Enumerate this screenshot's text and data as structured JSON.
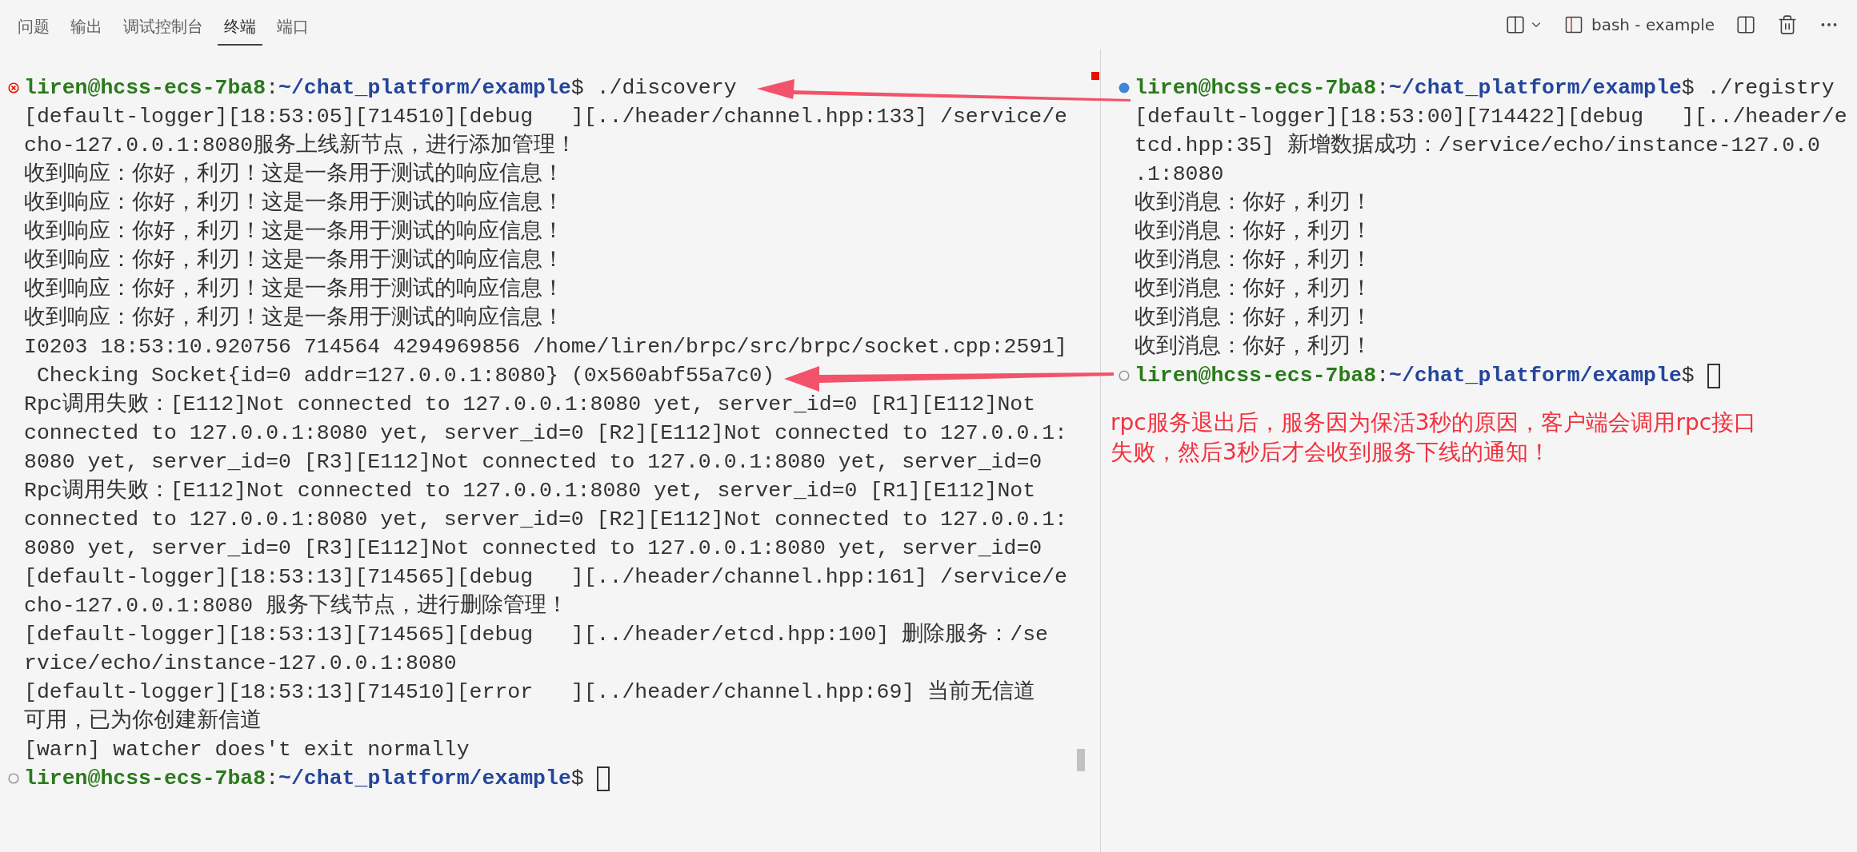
{
  "tabs": [
    {
      "label": "问题",
      "selected": false
    },
    {
      "label": "输出",
      "selected": false
    },
    {
      "label": "调试控制台",
      "selected": false
    },
    {
      "label": "终端",
      "selected": true
    },
    {
      "label": "端口",
      "selected": false
    }
  ],
  "terminal_name": "bash - example",
  "terminals": [
    {
      "lines": [
        {
          "kind": "prompt",
          "error": true,
          "color": "#e51400",
          "user": "liren@hcss-ecs-7ba8",
          "sep": ":",
          "path": "~/chat_platform/example",
          "symbol": "$",
          "command": "./discovery"
        },
        {
          "kind": "output",
          "text": "[default-logger][18:53:05][714510][debug   ][../header/channel.hpp:133] /service/e"
        },
        {
          "kind": "output",
          "text": "cho-127.0.0.1:8080服务上线新节点，进行添加管理！"
        },
        {
          "kind": "output",
          "text": "收到响应：你好，利刃！这是一条用于测试的响应信息！"
        },
        {
          "kind": "output",
          "text": "收到响应：你好，利刃！这是一条用于测试的响应信息！"
        },
        {
          "kind": "output",
          "text": "收到响应：你好，利刃！这是一条用于测试的响应信息！"
        },
        {
          "kind": "output",
          "text": "收到响应：你好，利刃！这是一条用于测试的响应信息！"
        },
        {
          "kind": "output",
          "text": "收到响应：你好，利刃！这是一条用于测试的响应信息！"
        },
        {
          "kind": "output",
          "text": "收到响应：你好，利刃！这是一条用于测试的响应信息！"
        },
        {
          "kind": "output",
          "text": "I0203 18:53:10.920756 714564 4294969856 /home/liren/brpc/src/brpc/socket.cpp:2591]"
        },
        {
          "kind": "output",
          "text": " Checking Socket{id=0 addr=127.0.0.1:8080} (0x560abf55a7c0)"
        },
        {
          "kind": "output",
          "text": "Rpc调用失败：[E112]Not connected to 127.0.0.1:8080 yet, server_id=0 [R1][E112]Not"
        },
        {
          "kind": "output",
          "text": "connected to 127.0.0.1:8080 yet, server_id=0 [R2][E112]Not connected to 127.0.0.1:"
        },
        {
          "kind": "output",
          "text": "8080 yet, server_id=0 [R3][E112]Not connected to 127.0.0.1:8080 yet, server_id=0"
        },
        {
          "kind": "output",
          "text": "Rpc调用失败：[E112]Not connected to 127.0.0.1:8080 yet, server_id=0 [R1][E112]Not"
        },
        {
          "kind": "output",
          "text": "connected to 127.0.0.1:8080 yet, server_id=0 [R2][E112]Not connected to 127.0.0.1:"
        },
        {
          "kind": "output",
          "text": "8080 yet, server_id=0 [R3][E112]Not connected to 127.0.0.1:8080 yet, server_id=0"
        },
        {
          "kind": "output",
          "text": "[default-logger][18:53:13][714565][debug   ][../header/channel.hpp:161] /service/e"
        },
        {
          "kind": "output",
          "text": "cho-127.0.0.1:8080 服务下线节点，进行删除管理！"
        },
        {
          "kind": "output",
          "text": "[default-logger][18:53:13][714565][debug   ][../header/etcd.hpp:100] 删除服务：/se"
        },
        {
          "kind": "output",
          "text": "rvice/echo/instance-127.0.0.1:8080"
        },
        {
          "kind": "output",
          "text": "[default-logger][18:53:13][714510][error   ][../header/channel.hpp:69] 当前无信道"
        },
        {
          "kind": "output",
          "text": "可用，已为你创建新信道"
        },
        {
          "kind": "output",
          "text": "[warn] watcher does't exit normally"
        },
        {
          "kind": "prompt",
          "error": false,
          "filled": false,
          "color": "#999999",
          "user": "liren@hcss-ecs-7ba8",
          "sep": ":",
          "path": "~/chat_platform/example",
          "symbol": "$",
          "cursor": true
        }
      ]
    },
    {
      "lines": [
        {
          "kind": "prompt",
          "error": false,
          "filled": true,
          "color": "#3f87d6",
          "user": "liren@hcss-ecs-7ba8",
          "sep": ":",
          "path": "~/chat_platform/example",
          "symbol": "$",
          "command": "./registry"
        },
        {
          "kind": "output",
          "text": "[default-logger][18:53:00][714422][debug   ][../header/e"
        },
        {
          "kind": "output",
          "text": "tcd.hpp:35] 新增数据成功：/service/echo/instance-127.0.0"
        },
        {
          "kind": "output",
          "text": ".1:8080"
        },
        {
          "kind": "output",
          "text": "收到消息：你好，利刃！"
        },
        {
          "kind": "output",
          "text": "收到消息：你好，利刃！"
        },
        {
          "kind": "output",
          "text": "收到消息：你好，利刃！"
        },
        {
          "kind": "output",
          "text": "收到消息：你好，利刃！"
        },
        {
          "kind": "output",
          "text": "收到消息：你好，利刃！"
        },
        {
          "kind": "output",
          "text": "收到消息：你好，利刃！"
        },
        {
          "kind": "prompt",
          "error": false,
          "filled": false,
          "color": "#999999",
          "user": "liren@hcss-ecs-7ba8",
          "sep": ":",
          "path": "~/chat_platform/example",
          "symbol": "$",
          "cursor": true
        }
      ],
      "annotation": [
        "rpc服务退出后，服务因为保活3秒的原因，客户端会调用rpc接口",
        "失败，然后3秒后才会收到服务下线的通知！"
      ]
    }
  ]
}
